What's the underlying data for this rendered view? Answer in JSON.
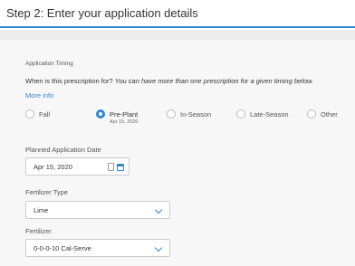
{
  "header": {
    "title": "Step 2: Enter your application details"
  },
  "timing": {
    "section_label": "Application Timing",
    "question_plain": "When is this prescription for? ",
    "question_italic": "You can have more than one prescription for a given timing below.",
    "more_info": "More info",
    "options": [
      {
        "label": "Fall",
        "selected": false,
        "sub": ""
      },
      {
        "label": "Pre-Plant",
        "selected": true,
        "sub": "Apr 15, 2020"
      },
      {
        "label": "In-Season",
        "selected": false,
        "sub": ""
      },
      {
        "label": "Late-Season",
        "selected": false,
        "sub": ""
      },
      {
        "label": "Other",
        "selected": false,
        "sub": ""
      }
    ]
  },
  "planned_date": {
    "label": "Planned Application Date",
    "value": "Apr 15, 2020"
  },
  "fertilizer_type": {
    "label": "Fertilizer Type",
    "value": "Lime"
  },
  "fertilizer": {
    "label": "Fertilizer",
    "value": "0-0-0-10 Cal-Serve"
  },
  "colors": {
    "accent": "#2f86d6",
    "panel": "#f7f7f7"
  }
}
